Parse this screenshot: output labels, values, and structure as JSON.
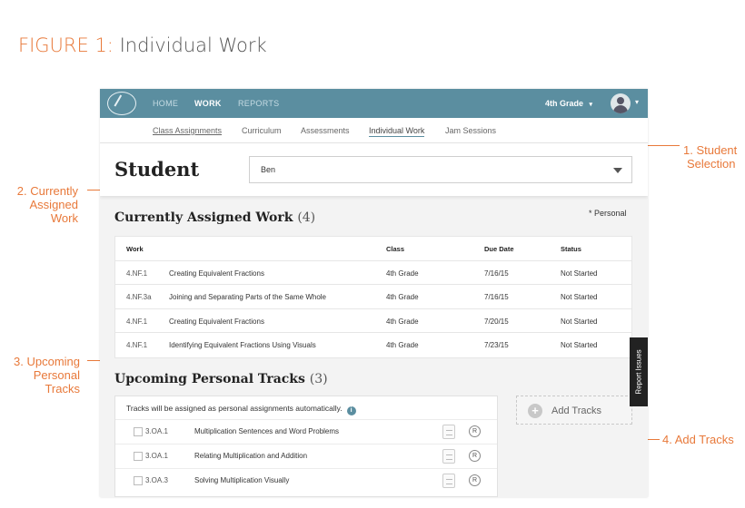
{
  "figure": {
    "label": "FIGURE 1:",
    "title": "Individual Work"
  },
  "annotations": {
    "student_selection": [
      "1. Student",
      "Selection"
    ],
    "currently_assigned": [
      "2.  Currently",
      "Assigned",
      "Work"
    ],
    "upcoming_tracks": [
      "3. Upcoming",
      "Personal",
      "Tracks"
    ],
    "add_tracks": "4. Add Tracks"
  },
  "colors": {
    "accent": "#e8793a",
    "topbar": "#5b8ea0"
  },
  "topbar": {
    "nav": [
      "HOME",
      "WORK",
      "REPORTS"
    ],
    "active": "WORK",
    "grade": "4th Grade"
  },
  "subnav": [
    "Class Assignments",
    "Curriculum",
    "Assessments",
    "Individual Work",
    "Jam Sessions"
  ],
  "student": {
    "label": "Student",
    "selected": "Ben"
  },
  "current_work": {
    "title": "Currently Assigned Work",
    "count": "(4)",
    "note": "* Personal",
    "headers": {
      "work": "Work",
      "class": "Class",
      "due": "Due Date",
      "status": "Status"
    },
    "rows": [
      {
        "code": "4.NF.1",
        "name": "Creating Equivalent Fractions",
        "class": "4th Grade",
        "due": "7/16/15",
        "status": "Not Started"
      },
      {
        "code": "4.NF.3a",
        "name": "Joining and Separating Parts of the Same Whole",
        "class": "4th Grade",
        "due": "7/16/15",
        "status": "Not Started"
      },
      {
        "code": "4.NF.1",
        "name": "Creating Equivalent Fractions",
        "class": "4th Grade",
        "due": "7/20/15",
        "status": "Not Started"
      },
      {
        "code": "4.NF.1",
        "name": "Identifying Equivalent Fractions Using Visuals",
        "class": "4th Grade",
        "due": "7/23/15",
        "status": "Not Started"
      }
    ]
  },
  "personal_tracks": {
    "title": "Upcoming Personal Tracks",
    "count": "(3)",
    "note": "Tracks will be assigned as personal assignments automatically.",
    "info_icon": "i",
    "rows": [
      {
        "code": "3.OA.1",
        "name": "Multiplication Sentences and Word Problems",
        "r": "R"
      },
      {
        "code": "3.OA.1",
        "name": "Relating Multiplication and Addition",
        "r": "R"
      },
      {
        "code": "3.OA.3",
        "name": "Solving Multiplication Visually",
        "r": "R"
      }
    ],
    "add_button": "Add Tracks"
  },
  "report_tab": "Report Issues"
}
